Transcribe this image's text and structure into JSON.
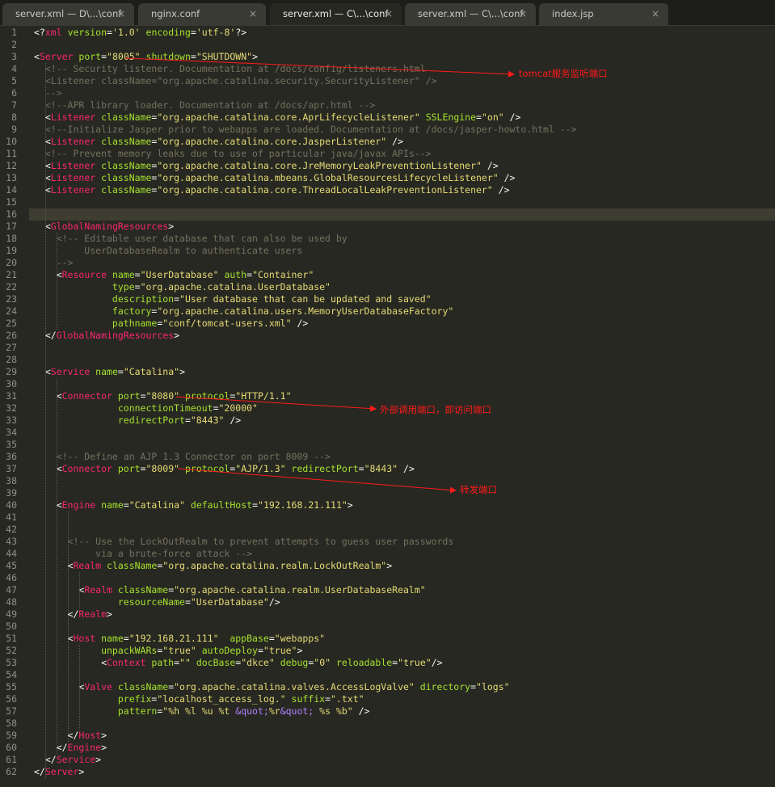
{
  "tabs": [
    {
      "label": "server.xml — D\\...\\conf",
      "active": false
    },
    {
      "label": "nginx.conf",
      "active": false
    },
    {
      "label": "server.xml — C\\...\\conf",
      "active": true
    },
    {
      "label": "server.xml — C\\...\\conf",
      "active": false
    },
    {
      "label": "index.jsp",
      "active": false
    }
  ],
  "tab_close_glyph": "×",
  "highlighted_line": 16,
  "annotations": [
    {
      "text": "tomcat服务监听端口",
      "points_to_line": 3
    },
    {
      "text": "外部调用端口，即访问端口",
      "points_to_line": 31
    },
    {
      "text": "转发端口",
      "points_to_line": 37
    }
  ],
  "colors": {
    "background": "#272822",
    "tag": "#f92672",
    "attribute": "#a6e22e",
    "string": "#e6db74",
    "comment": "#75715e",
    "entity": "#ae81ff",
    "annotation": "#ff1a1a"
  },
  "lines": [
    [
      [
        "p",
        "<?"
      ],
      [
        "t",
        "xml"
      ],
      [
        "a",
        " version"
      ],
      [
        "p",
        "="
      ],
      [
        "s",
        "'1.0'"
      ],
      [
        "a",
        " encoding"
      ],
      [
        "p",
        "="
      ],
      [
        "s",
        "'utf-8'"
      ],
      [
        "p",
        "?>"
      ]
    ],
    [],
    [
      [
        "p",
        "<"
      ],
      [
        "t",
        "Server"
      ],
      [
        "a",
        " port"
      ],
      [
        "p",
        "="
      ],
      [
        "s",
        "\"8005\""
      ],
      [
        "a",
        " shutdown"
      ],
      [
        "p",
        "="
      ],
      [
        "s",
        "\"SHUTDOWN\""
      ],
      [
        "p",
        ">"
      ]
    ],
    [
      [
        "c",
        "  <!-- Security listener. Documentation at /docs/config/listeners.html"
      ]
    ],
    [
      [
        "c",
        "  <Listener className=\"org.apache.catalina.security.SecurityListener\" />"
      ]
    ],
    [
      [
        "c",
        "  -->"
      ]
    ],
    [
      [
        "c",
        "  <!--APR library loader. Documentation at /docs/apr.html -->"
      ]
    ],
    [
      [
        "p",
        "  <"
      ],
      [
        "t",
        "Listener"
      ],
      [
        "a",
        " className"
      ],
      [
        "p",
        "="
      ],
      [
        "s",
        "\"org.apache.catalina.core.AprLifecycleListener\""
      ],
      [
        "a",
        " SSLEngine"
      ],
      [
        "p",
        "="
      ],
      [
        "s",
        "\"on\""
      ],
      [
        "p",
        " />"
      ]
    ],
    [
      [
        "c",
        "  <!--Initialize Jasper prior to webapps are loaded. Documentation at /docs/jasper-howto.html -->"
      ]
    ],
    [
      [
        "p",
        "  <"
      ],
      [
        "t",
        "Listener"
      ],
      [
        "a",
        " className"
      ],
      [
        "p",
        "="
      ],
      [
        "s",
        "\"org.apache.catalina.core.JasperListener\""
      ],
      [
        "p",
        " />"
      ]
    ],
    [
      [
        "c",
        "  <!-- Prevent memory leaks due to use of particular java/javax APIs-->"
      ]
    ],
    [
      [
        "p",
        "  <"
      ],
      [
        "t",
        "Listener"
      ],
      [
        "a",
        " className"
      ],
      [
        "p",
        "="
      ],
      [
        "s",
        "\"org.apache.catalina.core.JreMemoryLeakPreventionListener\""
      ],
      [
        "p",
        " />"
      ]
    ],
    [
      [
        "p",
        "  <"
      ],
      [
        "t",
        "Listener"
      ],
      [
        "a",
        " className"
      ],
      [
        "p",
        "="
      ],
      [
        "s",
        "\"org.apache.catalina.mbeans.GlobalResourcesLifecycleListener\""
      ],
      [
        "p",
        " />"
      ]
    ],
    [
      [
        "p",
        "  <"
      ],
      [
        "t",
        "Listener"
      ],
      [
        "a",
        " className"
      ],
      [
        "p",
        "="
      ],
      [
        "s",
        "\"org.apache.catalina.core.ThreadLocalLeakPreventionListener\""
      ],
      [
        "p",
        " />"
      ]
    ],
    [],
    [],
    [
      [
        "p",
        "  <"
      ],
      [
        "t",
        "GlobalNamingResources"
      ],
      [
        "p",
        ">"
      ]
    ],
    [
      [
        "c",
        "    <!-- Editable user database that can also be used by"
      ]
    ],
    [
      [
        "c",
        "         UserDatabaseRealm to authenticate users"
      ]
    ],
    [
      [
        "c",
        "    -->"
      ]
    ],
    [
      [
        "p",
        "    <"
      ],
      [
        "t",
        "Resource"
      ],
      [
        "a",
        " name"
      ],
      [
        "p",
        "="
      ],
      [
        "s",
        "\"UserDatabase\""
      ],
      [
        "a",
        " auth"
      ],
      [
        "p",
        "="
      ],
      [
        "s",
        "\"Container\""
      ]
    ],
    [
      [
        "a",
        "              type"
      ],
      [
        "p",
        "="
      ],
      [
        "s",
        "\"org.apache.catalina.UserDatabase\""
      ]
    ],
    [
      [
        "a",
        "              description"
      ],
      [
        "p",
        "="
      ],
      [
        "s",
        "\"User database that can be updated and saved\""
      ]
    ],
    [
      [
        "a",
        "              factory"
      ],
      [
        "p",
        "="
      ],
      [
        "s",
        "\"org.apache.catalina.users.MemoryUserDatabaseFactory\""
      ]
    ],
    [
      [
        "a",
        "              pathname"
      ],
      [
        "p",
        "="
      ],
      [
        "s",
        "\"conf/tomcat-users.xml\""
      ],
      [
        "p",
        " />"
      ]
    ],
    [
      [
        "p",
        "  </"
      ],
      [
        "t",
        "GlobalNamingResources"
      ],
      [
        "p",
        ">"
      ]
    ],
    [],
    [],
    [
      [
        "p",
        "  <"
      ],
      [
        "t",
        "Service"
      ],
      [
        "a",
        " name"
      ],
      [
        "p",
        "="
      ],
      [
        "s",
        "\"Catalina\""
      ],
      [
        "p",
        ">"
      ]
    ],
    [],
    [
      [
        "p",
        "    <"
      ],
      [
        "t",
        "Connector"
      ],
      [
        "a",
        " port"
      ],
      [
        "p",
        "="
      ],
      [
        "s",
        "\"8080\""
      ],
      [
        "a",
        " protocol"
      ],
      [
        "p",
        "="
      ],
      [
        "s",
        "\"HTTP/1.1\""
      ]
    ],
    [
      [
        "a",
        "               connectionTimeout"
      ],
      [
        "p",
        "="
      ],
      [
        "s",
        "\"20000\""
      ]
    ],
    [
      [
        "a",
        "               redirectPort"
      ],
      [
        "p",
        "="
      ],
      [
        "s",
        "\"8443\""
      ],
      [
        "p",
        " />"
      ]
    ],
    [],
    [],
    [
      [
        "c",
        "    <!-- Define an AJP 1.3 Connector on port 8009 -->"
      ]
    ],
    [
      [
        "p",
        "    <"
      ],
      [
        "t",
        "Connector"
      ],
      [
        "a",
        " port"
      ],
      [
        "p",
        "="
      ],
      [
        "s",
        "\"8009\""
      ],
      [
        "a",
        " protocol"
      ],
      [
        "p",
        "="
      ],
      [
        "s",
        "\"AJP/1.3\""
      ],
      [
        "a",
        " redirectPort"
      ],
      [
        "p",
        "="
      ],
      [
        "s",
        "\"8443\""
      ],
      [
        "p",
        " />"
      ]
    ],
    [],
    [],
    [
      [
        "p",
        "    <"
      ],
      [
        "t",
        "Engine"
      ],
      [
        "a",
        " name"
      ],
      [
        "p",
        "="
      ],
      [
        "s",
        "\"Catalina\""
      ],
      [
        "a",
        " defaultHost"
      ],
      [
        "p",
        "="
      ],
      [
        "s",
        "\"192.168.21.111\""
      ],
      [
        "p",
        ">"
      ]
    ],
    [],
    [],
    [
      [
        "c",
        "      <!-- Use the LockOutRealm to prevent attempts to guess user passwords"
      ]
    ],
    [
      [
        "c",
        "           via a brute-force attack -->"
      ]
    ],
    [
      [
        "p",
        "      <"
      ],
      [
        "t",
        "Realm"
      ],
      [
        "a",
        " className"
      ],
      [
        "p",
        "="
      ],
      [
        "s",
        "\"org.apache.catalina.realm.LockOutRealm\""
      ],
      [
        "p",
        ">"
      ]
    ],
    [],
    [
      [
        "p",
        "        <"
      ],
      [
        "t",
        "Realm"
      ],
      [
        "a",
        " className"
      ],
      [
        "p",
        "="
      ],
      [
        "s",
        "\"org.apache.catalina.realm.UserDatabaseRealm\""
      ]
    ],
    [
      [
        "a",
        "               resourceName"
      ],
      [
        "p",
        "="
      ],
      [
        "s",
        "\"UserDatabase\""
      ],
      [
        "p",
        "/>"
      ]
    ],
    [
      [
        "p",
        "      </"
      ],
      [
        "t",
        "Realm"
      ],
      [
        "p",
        ">"
      ]
    ],
    [],
    [
      [
        "p",
        "      <"
      ],
      [
        "t",
        "Host"
      ],
      [
        "a",
        " name"
      ],
      [
        "p",
        "="
      ],
      [
        "s",
        "\"192.168.21.111\""
      ],
      [
        "a",
        "  appBase"
      ],
      [
        "p",
        "="
      ],
      [
        "s",
        "\"webapps\""
      ]
    ],
    [
      [
        "a",
        "            unpackWARs"
      ],
      [
        "p",
        "="
      ],
      [
        "s",
        "\"true\""
      ],
      [
        "a",
        " autoDeploy"
      ],
      [
        "p",
        "="
      ],
      [
        "s",
        "\"true\""
      ],
      [
        "p",
        ">"
      ]
    ],
    [
      [
        "p",
        "            <"
      ],
      [
        "t",
        "Context"
      ],
      [
        "a",
        " path"
      ],
      [
        "p",
        "="
      ],
      [
        "s",
        "\"\""
      ],
      [
        "a",
        " docBase"
      ],
      [
        "p",
        "="
      ],
      [
        "s",
        "\"dkce\""
      ],
      [
        "a",
        " debug"
      ],
      [
        "p",
        "="
      ],
      [
        "s",
        "\"0\""
      ],
      [
        "a",
        " reloadable"
      ],
      [
        "p",
        "="
      ],
      [
        "s",
        "\"true\""
      ],
      [
        "p",
        "/>"
      ]
    ],
    [],
    [
      [
        "p",
        "        <"
      ],
      [
        "t",
        "Valve"
      ],
      [
        "a",
        " className"
      ],
      [
        "p",
        "="
      ],
      [
        "s",
        "\"org.apache.catalina.valves.AccessLogValve\""
      ],
      [
        "a",
        " directory"
      ],
      [
        "p",
        "="
      ],
      [
        "s",
        "\"logs\""
      ]
    ],
    [
      [
        "a",
        "               prefix"
      ],
      [
        "p",
        "="
      ],
      [
        "s",
        "\"localhost_access_log.\""
      ],
      [
        "a",
        " suffix"
      ],
      [
        "p",
        "="
      ],
      [
        "s",
        "\".txt\""
      ]
    ],
    [
      [
        "a",
        "               pattern"
      ],
      [
        "p",
        "="
      ],
      [
        "s",
        "\"%h %l %u %t "
      ],
      [
        "e",
        "&quot;"
      ],
      [
        "s",
        "%r"
      ],
      [
        "e",
        "&quot;"
      ],
      [
        "s",
        " %s %b\""
      ],
      [
        "p",
        " />"
      ]
    ],
    [],
    [
      [
        "p",
        "      </"
      ],
      [
        "t",
        "Host"
      ],
      [
        "p",
        ">"
      ]
    ],
    [
      [
        "p",
        "    </"
      ],
      [
        "t",
        "Engine"
      ],
      [
        "p",
        ">"
      ]
    ],
    [
      [
        "p",
        "  </"
      ],
      [
        "t",
        "Service"
      ],
      [
        "p",
        ">"
      ]
    ],
    [
      [
        "p",
        "</"
      ],
      [
        "t",
        "Server"
      ],
      [
        "p",
        ">"
      ]
    ]
  ]
}
